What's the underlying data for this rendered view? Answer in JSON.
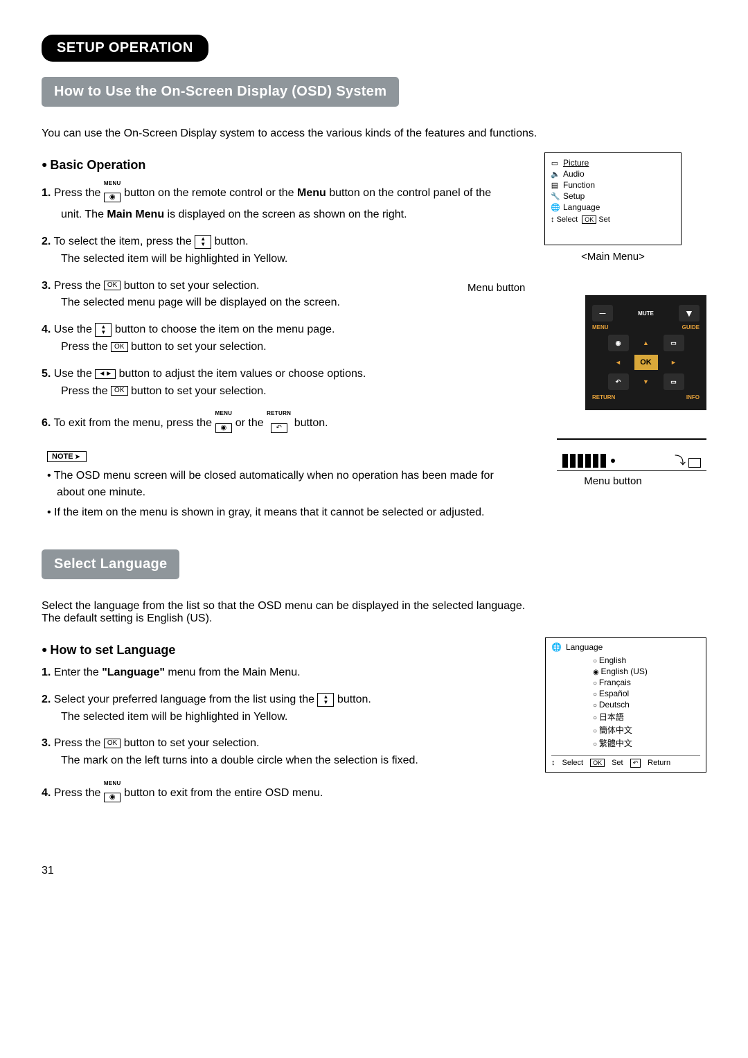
{
  "section_title": "SETUP OPERATION",
  "osd_title": "How to Use the On-Screen Display (OSD) System",
  "intro": "You can use the On-Screen Display system to access the various kinds of the features and functions.",
  "basic_heading": "Basic Operation",
  "btn_menu_label": "MENU",
  "btn_return_label": "RETURN",
  "btn_ok": "OK",
  "btn_updown": "▲▼",
  "btn_leftright": "◄►",
  "step1_a": "Press the",
  "step1_b": "button on the remote control or the",
  "step1_menu": "Menu",
  "step1_c": "button on the control panel of the unit. The",
  "step1_mainmenu": "Main Menu",
  "step1_d": "is displayed on the screen as shown on the right.",
  "step2_a": "To select the item, press the",
  "step2_b": "button.",
  "step2_c": "The selected item will be highlighted in Yellow.",
  "step3_a": "Press the",
  "step3_b": "button to set your selection.",
  "step3_c": "The selected menu page will be displayed on the screen.",
  "step4_a": "Use the",
  "step4_b": "button to choose the item on the menu page.",
  "step4_c": "Press the",
  "step4_d": "button to set your selection.",
  "step5_a": "Use the",
  "step5_b": "button to adjust the item values or choose options.",
  "step5_c": "Press the",
  "step5_d": "button to set your selection.",
  "step6_a": "To exit from the menu, press the",
  "step6_b": "or the",
  "step6_c": "button.",
  "note_tag": "NOTE",
  "note1": "The OSD menu screen will be closed automatically when no operation has been made for about one minute.",
  "note2": "If the item on the menu is shown in gray, it means that it cannot be selected or adjusted.",
  "mainmenu_caption": "<Main Menu>",
  "mainmenu_items": {
    "picture": "Picture",
    "audio": "Audio",
    "function": "Function",
    "setup": "Setup",
    "language": "Language"
  },
  "mainmenu_footer_select": "Select",
  "mainmenu_footer_ok": "OK",
  "mainmenu_footer_set": "Set",
  "menu_button_label": "Menu button",
  "remote": {
    "mute": "MUTE",
    "menu": "MENU",
    "guide": "GUIDE",
    "return": "RETURN",
    "info": "INFO",
    "ok": "OK"
  },
  "panel_label": "Menu button",
  "lang_title": "Select Language",
  "lang_intro_a": "Select the language from the list so that the OSD menu can be displayed in the selected language.",
  "lang_intro_b": "The default setting is English (US).",
  "lang_heading": "How to set Language",
  "lstep1_a": "Enter the",
  "lstep1_q": "\"Language\"",
  "lstep1_b": "menu from the Main Menu.",
  "lstep2_a": "Select your preferred language from the list using the",
  "lstep2_b": "button.",
  "lstep2_c": "The selected item will be highlighted in Yellow.",
  "lstep3_a": "Press the",
  "lstep3_b": "button to set your selection.",
  "lstep3_c": "The mark on the left turns into a double circle when the selection is fixed.",
  "lstep4_a": "Press the",
  "lstep4_b": "button to exit from the entire OSD menu.",
  "langbox_title": "Language",
  "langbox_items": {
    "english": "English",
    "english_us": "English (US)",
    "francais": "Français",
    "espanol": "Español",
    "deutsch": "Deutsch",
    "japanese": "日本語",
    "sc": "簡体中文",
    "tc": "繁體中文"
  },
  "langbox_footer": {
    "select": "Select",
    "ok": "OK",
    "set": "Set",
    "return": "Return"
  },
  "page_number": "31"
}
